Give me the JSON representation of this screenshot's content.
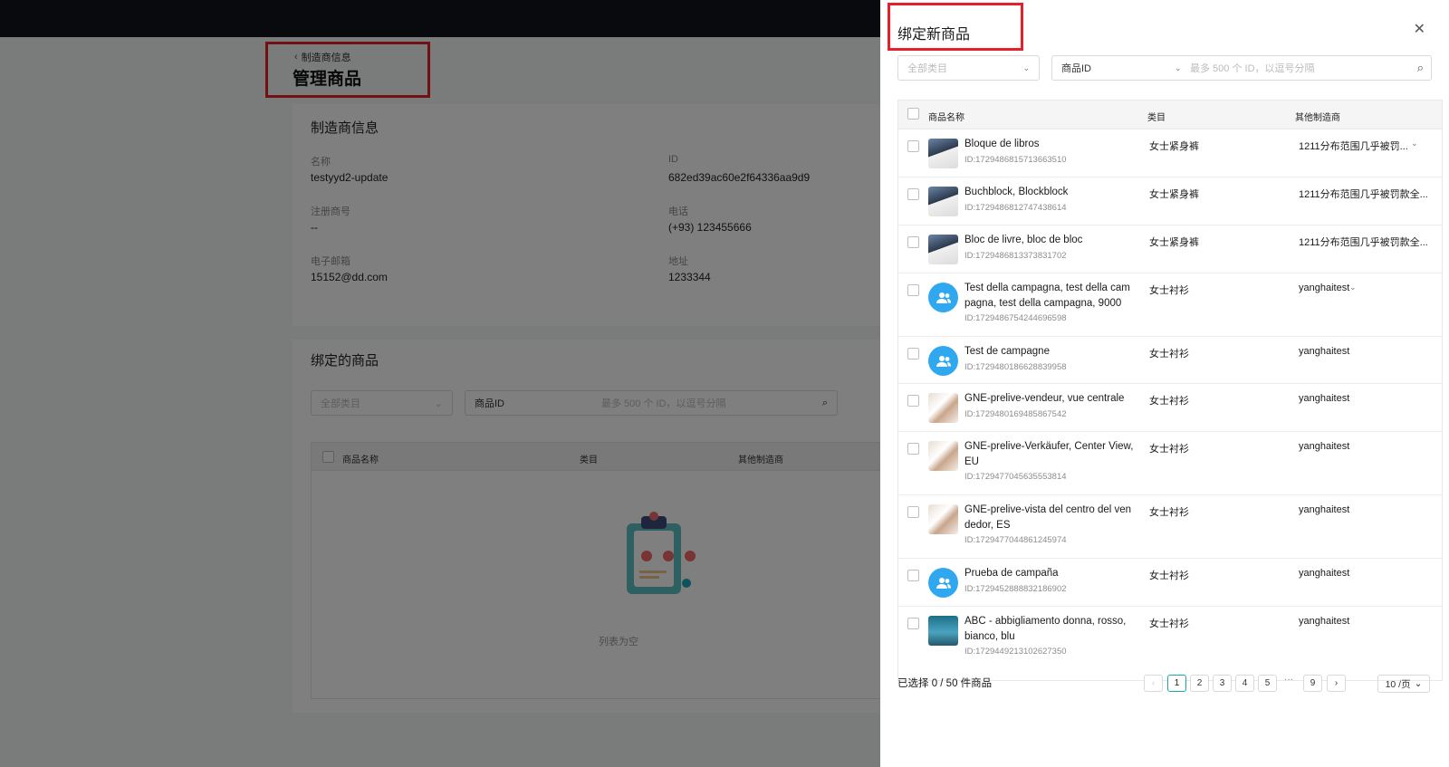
{
  "page": {
    "back_label": "制造商信息",
    "title": "管理商品"
  },
  "manufacturer_info": {
    "section_title": "制造商信息",
    "fields": {
      "name_label": "名称",
      "name_value": "testyyd2-update",
      "id_label": "ID",
      "id_value": "682ed39ac60e2f64336aa9d9",
      "reg_label": "注册商号",
      "reg_value": "--",
      "phone_label": "电话",
      "phone_value": "(+93) 123455666",
      "email_label": "电子邮箱",
      "email_value": "15152@dd.com",
      "address_label": "地址",
      "address_value": "1233344"
    }
  },
  "bound_products": {
    "section_title": "绑定的商品",
    "category_placeholder": "全部类目",
    "search_field": "商品ID",
    "search_placeholder": "最多 500 个 ID，以逗号分隔",
    "columns": {
      "name": "商品名称",
      "category": "类目",
      "other_maker": "其他制造商"
    },
    "empty_text": "列表为空"
  },
  "drawer": {
    "title": "绑定新商品",
    "close_icon": "close-icon",
    "category_placeholder": "全部类目",
    "search_field": "商品ID",
    "search_placeholder": "最多 500 个 ID，以逗号分隔",
    "columns": {
      "name": "商品名称",
      "category": "类目",
      "other_maker": "其他制造商"
    },
    "rows": [
      {
        "name": "Bloque de libros",
        "id": "ID:1729486815713663510",
        "category": "女士紧身裤",
        "maker": "1211分布范围几乎被罚...",
        "thumb": "photo-a"
      },
      {
        "name": "Buchblock, Blockblock",
        "id": "ID:1729486812747438614",
        "category": "女士紧身裤",
        "maker": "1211分布范围几乎被罚款全...",
        "thumb": "photo-a"
      },
      {
        "name": "Bloc de livre, bloc de bloc",
        "id": "ID:1729486813373831702",
        "category": "女士紧身裤",
        "maker": "1211分布范围几乎被罚款全...",
        "thumb": "photo-a"
      },
      {
        "name": "Test della campagna, test della cam pagna, test della campagna, 9000",
        "id": "ID:1729486754244696598",
        "category": "女士衬衫",
        "maker": "yanghaitest",
        "thumb": "avatar"
      },
      {
        "name": "Test de campagne",
        "id": "ID:1729480186628839958",
        "category": "女士衬衫",
        "maker": "yanghaitest",
        "thumb": "avatar"
      },
      {
        "name": "GNE-prelive-vendeur, vue centrale",
        "id": "ID:1729480169485867542",
        "category": "女士衬衫",
        "maker": "yanghaitest",
        "thumb": "photo-b"
      },
      {
        "name": "GNE-prelive-Verkäufer, Center View, EU",
        "id": "ID:1729477045635553814",
        "category": "女士衬衫",
        "maker": "yanghaitest",
        "thumb": "photo-b"
      },
      {
        "name": "GNE-prelive-vista del centro del ven dedor, ES",
        "id": "ID:1729477044861245974",
        "category": "女士衬衫",
        "maker": "yanghaitest",
        "thumb": "photo-b"
      },
      {
        "name": "Prueba de campaña",
        "id": "ID:1729452888832186902",
        "category": "女士衬衫",
        "maker": "yanghaitest",
        "thumb": "avatar"
      },
      {
        "name": "ABC - abbigliamento donna, rosso, bianco, blu",
        "id": "ID:1729449213102627350",
        "category": "女士衬衫",
        "maker": "yanghaitest",
        "thumb": "photo-c"
      }
    ],
    "footer": {
      "selected_text": "已选择 0 / 50 件商品",
      "pages": [
        "1",
        "2",
        "3",
        "4",
        "5",
        "9"
      ],
      "ellipsis": "···",
      "page_size": "10 /页",
      "prev_icon": "chevron-left-icon",
      "next_icon": "chevron-right-icon"
    }
  },
  "colors": {
    "topbar": "#11141b",
    "highlight_box": "#e4212b",
    "active_page": "#1aa6b7",
    "avatar": "#2fa8f0"
  }
}
